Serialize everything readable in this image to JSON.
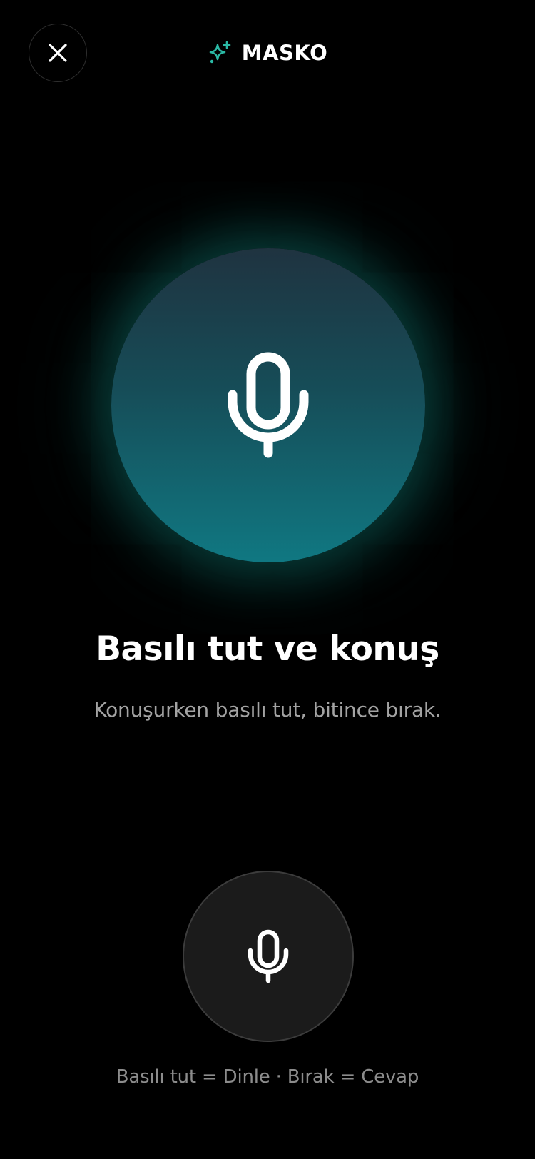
{
  "header": {
    "close_icon": "close-icon",
    "brand_icon": "sparkle-icon",
    "brand_name": "MASKO",
    "brand_icon_color": "#2bb9a5"
  },
  "orb": {
    "icon": "microphone-icon",
    "gradient_top": "#1f3340",
    "gradient_bottom": "#107882",
    "glow_color": "#14968c"
  },
  "main": {
    "title": "Basılı tut ve konuş",
    "subtitle": "Konuşurken basılı tut, bitince bırak."
  },
  "record_button": {
    "icon": "microphone-icon"
  },
  "footer": {
    "hint": "Basılı tut = Dinle · Bırak = Cevap"
  }
}
